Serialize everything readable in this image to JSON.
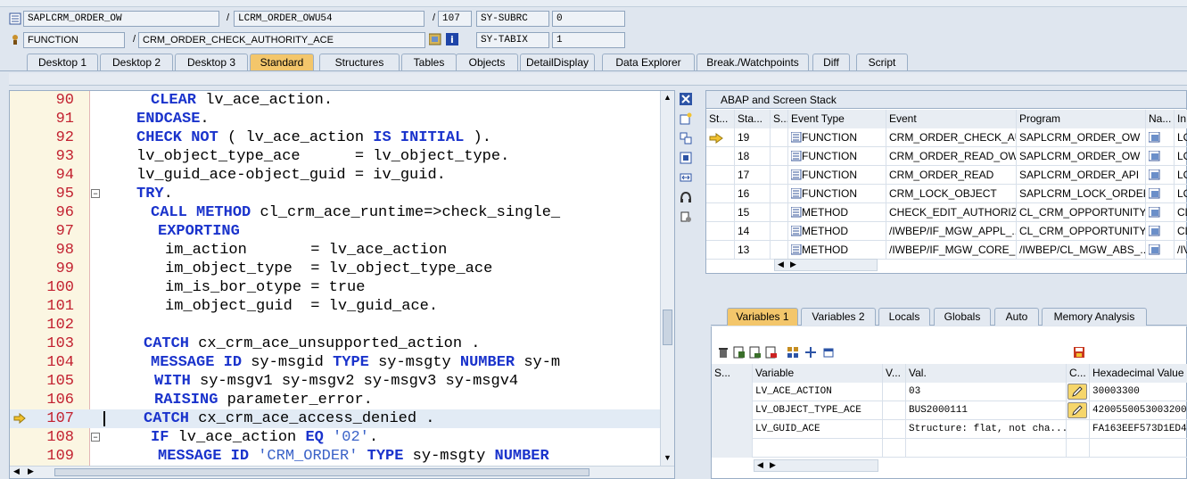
{
  "header": {
    "program_main": "SAPLCRM_ORDER_OW",
    "include": "LCRM_ORDER_OWU54",
    "line_number": "107",
    "subrc_label": "SY-SUBRC",
    "subrc_value": "0",
    "event_type": "FUNCTION",
    "event_name": "CRM_ORDER_CHECK_AUTHORITY_ACE",
    "tabix_label": "SY-TABIX",
    "tabix_value": "1",
    "slash1": "/",
    "slash2": "/",
    "slash3": "/"
  },
  "tabs": [
    {
      "label": "Desktop 1"
    },
    {
      "label": "Desktop 2"
    },
    {
      "label": "Desktop 3"
    },
    {
      "label": "Standard"
    },
    {
      "label": "Structures"
    },
    {
      "label": "Tables"
    },
    {
      "label": "Objects"
    },
    {
      "label": "DetailDisplay"
    },
    {
      "label": "Data Explorer"
    },
    {
      "label": "Break./Watchpoints"
    },
    {
      "label": "Diff"
    },
    {
      "label": "Script"
    }
  ],
  "code": {
    "lines": [
      {
        "num": "90",
        "text": "CLEAR lv_ace_action."
      },
      {
        "num": "91",
        "text": "ENDCASE."
      },
      {
        "num": "92",
        "text": "CHECK NOT ( lv_ace_action IS INITIAL )."
      },
      {
        "num": "93",
        "text": "lv_object_type_ace      = lv_object_type."
      },
      {
        "num": "94",
        "text": "lv_guid_ace-object_guid = iv_guid."
      },
      {
        "num": "95",
        "text": "TRY."
      },
      {
        "num": "96",
        "text": "CALL METHOD cl_crm_ace_runtime=>check_single_"
      },
      {
        "num": "97",
        "text": "EXPORTING"
      },
      {
        "num": "98",
        "text": "im_action       = lv_ace_action"
      },
      {
        "num": "99",
        "text": "im_object_type  = lv_object_type_ace"
      },
      {
        "num": "100",
        "text": "im_is_bor_otype = true"
      },
      {
        "num": "101",
        "text": "im_object_guid  = lv_guid_ace."
      },
      {
        "num": "102",
        "text": ""
      },
      {
        "num": "103",
        "text": "CATCH cx_crm_ace_unsupported_action ."
      },
      {
        "num": "104",
        "text": "MESSAGE ID sy-msgid TYPE sy-msgty NUMBER sy-m"
      },
      {
        "num": "105",
        "text": "WITH sy-msgv1 sy-msgv2 sy-msgv3 sy-msgv4"
      },
      {
        "num": "106",
        "text": "RAISING parameter_error."
      },
      {
        "num": "107",
        "text": "CATCH cx_crm_ace_access_denied ."
      },
      {
        "num": "108",
        "text": "IF lv_ace_action EQ '02'."
      },
      {
        "num": "109",
        "text": "MESSAGE ID 'CRM_ORDER' TYPE sy-msgty NUMBER"
      }
    ]
  },
  "stack": {
    "title": "ABAP and Screen Stack",
    "columns": [
      "St...",
      "Sta...",
      "S...",
      "Event Type",
      "Event",
      "Program",
      "Na...",
      "In"
    ],
    "rows": [
      {
        "level": "19",
        "type": "FUNCTION",
        "event": "CRM_ORDER_CHECK_AU...",
        "program": "SAPLCRM_ORDER_OW",
        "include": "LC"
      },
      {
        "level": "18",
        "type": "FUNCTION",
        "event": "CRM_ORDER_READ_OW",
        "program": "SAPLCRM_ORDER_OW",
        "include": "LC"
      },
      {
        "level": "17",
        "type": "FUNCTION",
        "event": "CRM_ORDER_READ",
        "program": "SAPLCRM_ORDER_API",
        "include": "LC"
      },
      {
        "level": "16",
        "type": "FUNCTION",
        "event": "CRM_LOCK_OBJECT",
        "program": "SAPLCRM_LOCK_ORDER",
        "include": "LC"
      },
      {
        "level": "15",
        "type": "METHOD",
        "event": "CHECK_EDIT_AUTHORIZ...",
        "program": "CL_CRM_OPPORTUNITY...",
        "include": "CL"
      },
      {
        "level": "14",
        "type": "METHOD",
        "event": "/IWBEP/IF_MGW_APPL_...",
        "program": "CL_CRM_OPPORTUNITY...",
        "include": "CL"
      },
      {
        "level": "13",
        "type": "METHOD",
        "event": "/IWBEP/IF_MGW_CORE_...",
        "program": "/IWBEP/CL_MGW_ABS_...",
        "include": "/IV"
      }
    ]
  },
  "vartabs": [
    {
      "label": "Variables 1"
    },
    {
      "label": "Variables 2"
    },
    {
      "label": "Locals"
    },
    {
      "label": "Globals"
    },
    {
      "label": "Auto"
    },
    {
      "label": "Memory Analysis"
    }
  ],
  "variables": {
    "columns": [
      "S...",
      "Variable",
      "V...",
      "Val.",
      "C...",
      "Hexadecimal Value"
    ],
    "rows": [
      {
        "name": "LV_ACE_ACTION",
        "value": "03",
        "hex": "30003300"
      },
      {
        "name": "LV_OBJECT_TYPE_ACE",
        "value": "BUS2000111",
        "hex": "42005500530032003200"
      },
      {
        "name": "LV_GUID_ACE",
        "value": "Structure: flat, not cha...",
        "hex": "FA163EEF573D1ED4"
      }
    ]
  },
  "colors": {
    "active_tab": "#f3c66b",
    "keyword": "#1a33cc",
    "line_number": "#c2202f"
  }
}
